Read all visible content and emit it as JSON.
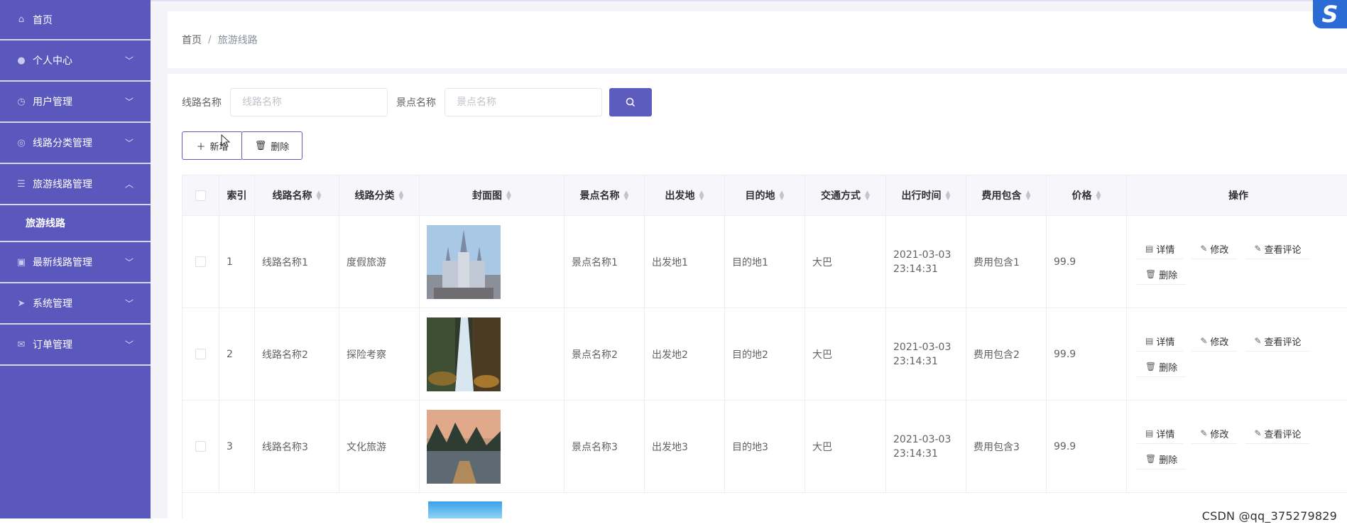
{
  "sidebar": {
    "items": [
      {
        "label": "首页",
        "icon": "home-icon",
        "chevron": ""
      },
      {
        "label": "个人中心",
        "icon": "user-icon",
        "chevron": "﹀"
      },
      {
        "label": "用户管理",
        "icon": "clock-icon",
        "chevron": "﹀"
      },
      {
        "label": "线路分类管理",
        "icon": "compass-icon",
        "chevron": "﹀"
      },
      {
        "label": "旅游线路管理",
        "icon": "sliders-icon",
        "chevron": "︿"
      },
      {
        "label": "最新线路管理",
        "icon": "image-icon",
        "chevron": "﹀"
      },
      {
        "label": "系统管理",
        "icon": "send-icon",
        "chevron": "﹀"
      },
      {
        "label": "订单管理",
        "icon": "mail-icon",
        "chevron": "﹀"
      }
    ],
    "sub_item": "旅游线路"
  },
  "breadcrumb": {
    "home": "首页",
    "separator": "/",
    "current": "旅游线路"
  },
  "search": {
    "route_label": "线路名称",
    "route_placeholder": "线路名称",
    "scenic_label": "景点名称",
    "scenic_placeholder": "景点名称"
  },
  "actions": {
    "add": "新增",
    "delete": "删除"
  },
  "table": {
    "headers": [
      "索引",
      "线路名称",
      "线路分类",
      "封面图",
      "景点名称",
      "出发地",
      "目的地",
      "交通方式",
      "出行时间",
      "费用包含",
      "价格",
      "操作"
    ],
    "rows": [
      {
        "index": "1",
        "name": "线路名称1",
        "category": "度假旅游",
        "cover": "castle-image",
        "scenic": "景点名称1",
        "from": "出发地1",
        "to": "目的地1",
        "transport": "大巴",
        "date": "2021-03-03",
        "time": "23:14:31",
        "fees": "费用包含1",
        "price": "99.9"
      },
      {
        "index": "2",
        "name": "线路名称2",
        "category": "探险考察",
        "cover": "waterfall-image",
        "scenic": "景点名称2",
        "from": "出发地2",
        "to": "目的地2",
        "transport": "大巴",
        "date": "2021-03-03",
        "time": "23:14:31",
        "fees": "费用包含2",
        "price": "99.9"
      },
      {
        "index": "3",
        "name": "线路名称3",
        "category": "文化旅游",
        "cover": "river-raft-image",
        "scenic": "景点名称3",
        "from": "出发地3",
        "to": "目的地3",
        "transport": "大巴",
        "date": "2021-03-03",
        "time": "23:14:31",
        "fees": "费用包含3",
        "price": "99.9"
      }
    ],
    "row_ops": {
      "detail": "详情",
      "edit": "修改",
      "comments": "查看评论",
      "delete": "删除"
    }
  },
  "watermark": "CSDN @qq_375279829",
  "brand_letter": "S",
  "colors": {
    "sidebar": "#5a58bd",
    "primary": "#5b5cbd",
    "brand": "#2a6bd6"
  }
}
